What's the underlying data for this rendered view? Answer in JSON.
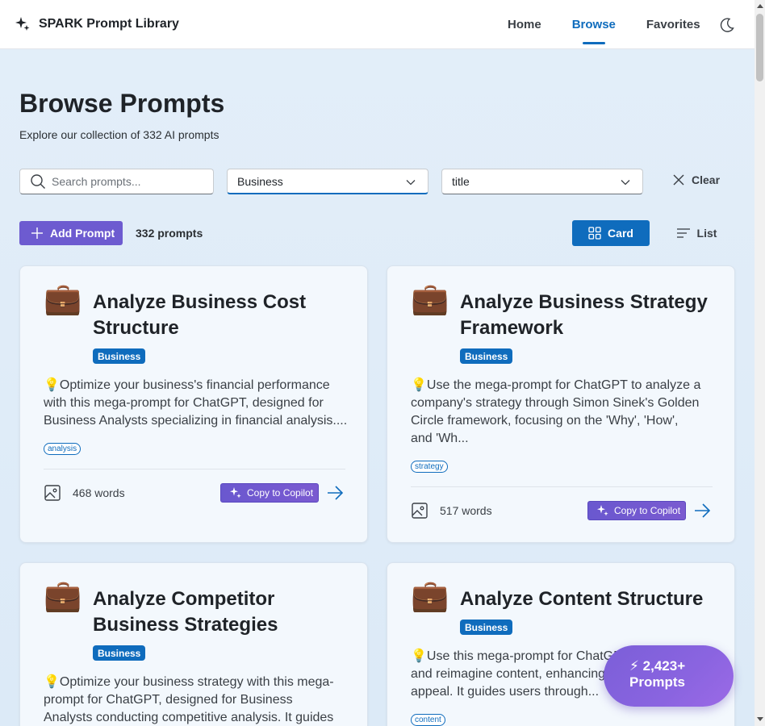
{
  "header": {
    "brand_title": "SPARK Prompt Library",
    "nav": [
      {
        "label": "Home",
        "active": false
      },
      {
        "label": "Browse",
        "active": true
      },
      {
        "label": "Favorites",
        "active": false
      }
    ],
    "theme_icon": "moon-icon"
  },
  "page": {
    "title": "Browse Prompts",
    "subtitle": "Explore our collection of 332 AI prompts"
  },
  "filters": {
    "search_placeholder": "Search prompts...",
    "search_value": "",
    "category_selected": "Business",
    "sort_selected": "title",
    "clear_label": "Clear"
  },
  "toolbar": {
    "add_label": "Add Prompt",
    "count_label": "332 prompts",
    "view_card_label": "Card",
    "view_list_label": "List",
    "active_view": "Card"
  },
  "cards": [
    {
      "emoji": "💼",
      "title": "Analyze Business Cost Structure",
      "category": "Business",
      "description": "💡Optimize your business's financial performance with this mega-prompt for ChatGPT, designed for Business Analysts specializing in financial analysis....",
      "tag": "analysis",
      "words": "468 words",
      "copilot_label": "Copy to Copilot"
    },
    {
      "emoji": "💼",
      "title": "Analyze Business Strategy Framework",
      "category": "Business",
      "description": "💡Use the mega-prompt for ChatGPT to analyze a company's strategy through Simon Sinek's Golden Circle framework, focusing on the 'Why', 'How', and 'Wh...",
      "tag": "strategy",
      "words": "517 words",
      "copilot_label": "Copy to Copilot"
    },
    {
      "emoji": "💼",
      "title": "Analyze Competitor Business Strategies",
      "category": "Business",
      "description": "💡Optimize your business strategy with this mega-prompt for ChatGPT, designed for Business Analysts conducting competitive analysis. It guides you thr...",
      "tag": "",
      "words": "",
      "copilot_label": ""
    },
    {
      "emoji": "💼",
      "title": "Analyze Content Structure",
      "category": "Business",
      "description": "💡Use this mega-prompt for ChatGPT to analyze and reimagine content, enhancing its clarity and appeal. It guides users through...",
      "tag": "content",
      "words": "",
      "copilot_label": ""
    }
  ],
  "floating_badge": {
    "icon": "⚡",
    "line1": "2,423+",
    "line2": "Prompts"
  },
  "colors": {
    "accent": "#0f6cbd",
    "add_button": "#6d5bd0",
    "copilot": "#6a58cf",
    "badge": "#8a64e0"
  }
}
